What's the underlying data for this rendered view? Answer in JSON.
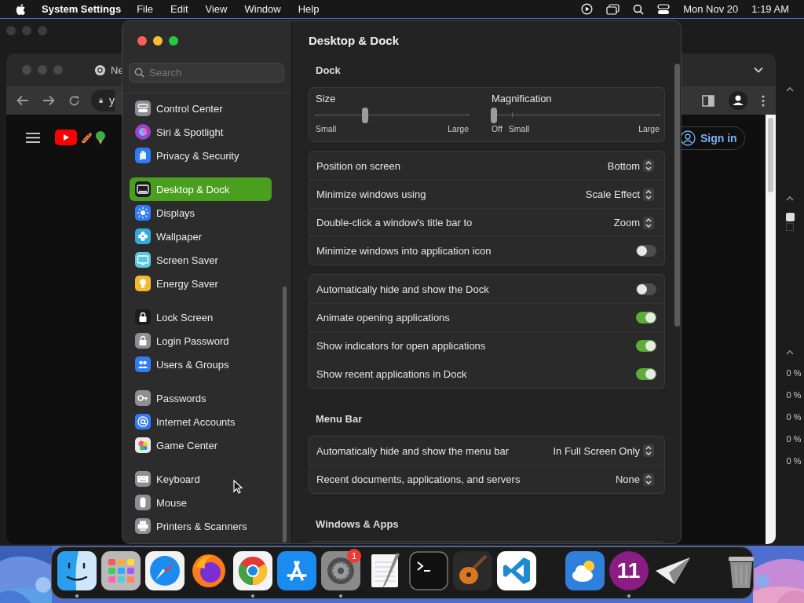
{
  "menu_bar": {
    "app_name": "System Settings",
    "menus": [
      "File",
      "Edit",
      "View",
      "Window",
      "Help"
    ],
    "date": "Mon Nov 20",
    "time": "1:19 AM"
  },
  "browser": {
    "tab_title": "Ne",
    "address": "y",
    "sign_in": "Sign in"
  },
  "side_window": {
    "percentages": [
      "0 %",
      "0 %",
      "0 %",
      "0 %",
      "0 %"
    ]
  },
  "settings": {
    "search": {
      "placeholder": "Search"
    },
    "sidebar": {
      "groups": [
        [
          {
            "label": "Control Center",
            "color": "#8e8e93",
            "selected": false
          },
          {
            "label": "Siri & Spotlight",
            "color": "#a23fd0",
            "selected": false
          },
          {
            "label": "Privacy & Security",
            "color": "#2f7cf6",
            "selected": false
          }
        ],
        [
          {
            "label": "Desktop & Dock",
            "color": "#1c1c1e",
            "selected": true
          },
          {
            "label": "Displays",
            "color": "#2f7cf6",
            "selected": false
          },
          {
            "label": "Wallpaper",
            "color": "#35aadc",
            "selected": false
          },
          {
            "label": "Screen Saver",
            "color": "#5ac8e0",
            "selected": false
          },
          {
            "label": "Energy Saver",
            "color": "#f5b82e",
            "selected": false
          }
        ],
        [
          {
            "label": "Lock Screen",
            "color": "#1c1c1e",
            "selected": false
          },
          {
            "label": "Login Password",
            "color": "#8e8e93",
            "selected": false
          },
          {
            "label": "Users & Groups",
            "color": "#2f7cf6",
            "selected": false
          }
        ],
        [
          {
            "label": "Passwords",
            "color": "#8e8e93",
            "selected": false
          },
          {
            "label": "Internet Accounts",
            "color": "#2f7cf6",
            "selected": false
          },
          {
            "label": "Game Center",
            "color": "#e8e8e8",
            "selected": false
          }
        ],
        [
          {
            "label": "Keyboard",
            "color": "#8e8e93",
            "selected": false
          },
          {
            "label": "Mouse",
            "color": "#8e8e93",
            "selected": false
          },
          {
            "label": "Printers & Scanners",
            "color": "#8e8e93",
            "selected": false
          }
        ]
      ]
    },
    "title": "Desktop & Dock",
    "sections": [
      {
        "heading": "Dock",
        "panels": [
          {
            "kind": "sliders",
            "sliders": [
              {
                "label": "Size",
                "level": 0.32,
                "ticks": [
                  "Small",
                  "Large"
                ]
              },
              {
                "label": "Magnification",
                "level": 0,
                "ticks": [
                  "Off",
                  "Small",
                  "Large"
                ]
              }
            ]
          },
          {
            "kind": "rows",
            "rows": [
              {
                "kind": "popup",
                "label": "Position on screen",
                "value": "Bottom"
              },
              {
                "kind": "popup",
                "label": "Minimize windows using",
                "value": "Scale Effect"
              },
              {
                "kind": "popup",
                "label": "Double-click a window's title bar to",
                "value": "Zoom"
              },
              {
                "kind": "toggle",
                "label": "Minimize windows into application icon",
                "on": false
              }
            ]
          },
          {
            "kind": "rows",
            "rows": [
              {
                "kind": "toggle",
                "label": "Automatically hide and show the Dock",
                "on": false
              },
              {
                "kind": "toggle",
                "label": "Animate opening applications",
                "on": true
              },
              {
                "kind": "toggle",
                "label": "Show indicators for open applications",
                "on": true
              },
              {
                "kind": "toggle",
                "label": "Show recent applications in Dock",
                "on": true
              }
            ]
          }
        ]
      },
      {
        "heading": "Menu Bar",
        "panels": [
          {
            "kind": "rows",
            "rows": [
              {
                "kind": "popup",
                "label": "Automatically hide and show the menu bar",
                "value": "In Full Screen Only"
              },
              {
                "kind": "popup",
                "label": "Recent documents, applications, and servers",
                "value": "None"
              }
            ]
          }
        ]
      },
      {
        "heading": "Windows & Apps",
        "panels": [
          {
            "kind": "clipped"
          }
        ]
      }
    ]
  },
  "dock": {
    "groups": [
      [
        {
          "kind": "finder",
          "running": true
        },
        {
          "kind": "launchpad",
          "running": false
        },
        {
          "kind": "safari",
          "running": false
        },
        {
          "kind": "firefox",
          "running": false
        },
        {
          "kind": "chrome",
          "running": true
        },
        {
          "kind": "appstore",
          "running": false
        },
        {
          "kind": "settings",
          "running": true,
          "badge": "1"
        },
        {
          "kind": "notes",
          "running": false
        },
        {
          "kind": "terminal",
          "running": false
        },
        {
          "kind": "guitar",
          "running": false
        },
        {
          "kind": "vscode",
          "running": false
        }
      ],
      [
        {
          "kind": "weather",
          "running": false
        },
        {
          "kind": "eleven",
          "running": true,
          "label": "11"
        },
        {
          "kind": "paper",
          "running": false
        }
      ],
      [
        {
          "kind": "trash",
          "running": false
        }
      ]
    ]
  }
}
